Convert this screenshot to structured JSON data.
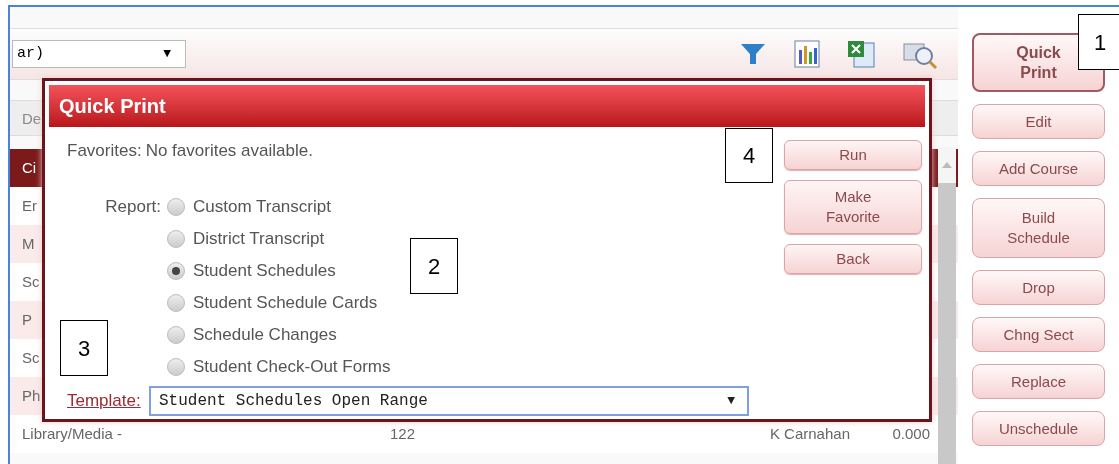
{
  "toolbar": {
    "view_select": {
      "value": "ar)",
      "arrow": "▼"
    }
  },
  "table": {
    "header": "De",
    "rows": [
      {
        "cells": [
          "Ci"
        ],
        "selected": true
      },
      {
        "cells": [
          "Er"
        ],
        "selected": false
      },
      {
        "cells": [
          "M"
        ],
        "selected": false
      },
      {
        "cells": [
          "Sc"
        ],
        "selected": false
      },
      {
        "cells": [
          "P"
        ],
        "selected": false
      },
      {
        "cells": [
          "Sc"
        ],
        "selected": false
      },
      {
        "cells": [
          "Ph"
        ],
        "selected": false
      },
      {
        "cells": [
          "Library/Media -",
          "122",
          "K Carnahan",
          "0.000"
        ],
        "selected": false
      }
    ]
  },
  "side_buttons": [
    {
      "label": "Quick Print",
      "primary": true
    },
    {
      "label": "Edit",
      "primary": false
    },
    {
      "label": "Add Course",
      "primary": false
    },
    {
      "label": "Build Schedule",
      "primary": false
    },
    {
      "label": "Drop",
      "primary": false
    },
    {
      "label": "Chng Sect",
      "primary": false
    },
    {
      "label": "Replace",
      "primary": false
    },
    {
      "label": "Unschedule",
      "primary": false
    }
  ],
  "dialog": {
    "title": "Quick Print",
    "favorites_label": "Favorites:",
    "favorites_value": "No favorites available.",
    "report_label": "Report:",
    "reports": [
      {
        "label": "Custom Transcript",
        "selected": false
      },
      {
        "label": "District Transcript",
        "selected": false
      },
      {
        "label": "Student Schedules",
        "selected": true
      },
      {
        "label": "Student Schedule Cards",
        "selected": false
      },
      {
        "label": "Schedule Changes",
        "selected": false
      },
      {
        "label": "Student Check-Out Forms",
        "selected": false
      }
    ],
    "template_label": "Template:",
    "template": {
      "value": "Student Schedules Open Range",
      "arrow": "▼"
    },
    "buttons": [
      "Run",
      "Make Favorite",
      "Back"
    ]
  },
  "callouts": [
    "1",
    "2",
    "3",
    "4"
  ]
}
